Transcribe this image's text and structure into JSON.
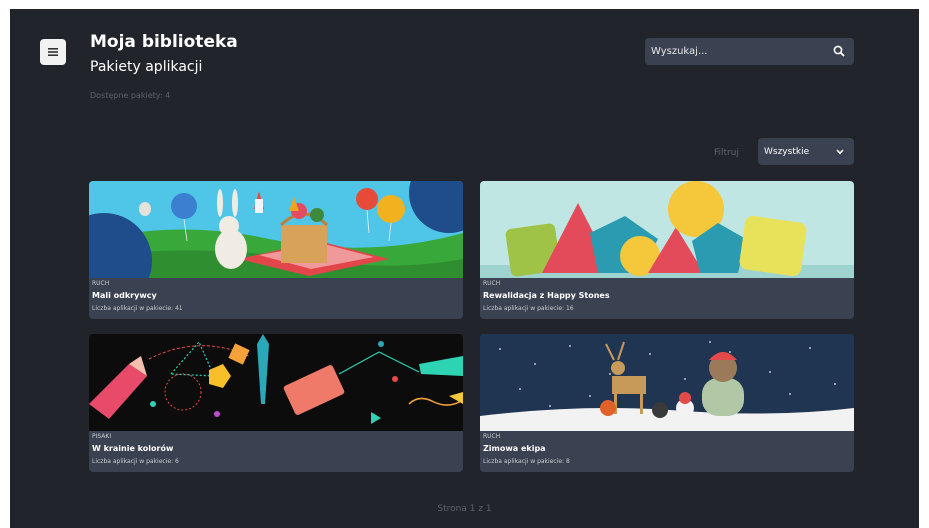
{
  "header": {
    "title": "Moja biblioteka",
    "subtitle": "Pakiety aplikacji",
    "packages_count": "Dostępne pakiety: 4"
  },
  "icons": {
    "menu": "hamburger-menu-icon",
    "search": "search-icon",
    "dropdown": "chevron-down-icon"
  },
  "search": {
    "placeholder": "Wyszukaj..."
  },
  "filter": {
    "label": "Filtruj",
    "selected": "Wszystkie"
  },
  "cards": [
    {
      "category": "RUCH",
      "name": "Mali odkrywcy",
      "meta": "Liczba aplikacji w pakiecie: 41",
      "image": "rabbit-picnic-illustration"
    },
    {
      "category": "RUCH",
      "name": "Rewalidacja z Happy Stones",
      "meta": "Liczba aplikacji w pakiecie: 16",
      "image": "colorful-shapes-illustration"
    },
    {
      "category": "PISAKI",
      "name": "W krainie kolorów",
      "meta": "Liczba aplikacji w pakiecie: 6",
      "image": "markers-drawing-illustration"
    },
    {
      "category": "RUCH",
      "name": "Zimowa ekipa",
      "meta": "Liczba aplikacji w pakiecie: 8",
      "image": "winter-animals-illustration"
    }
  ],
  "pagination": {
    "text": "Strona 1 z 1"
  },
  "colors": {
    "background": "#21252b",
    "panel": "#3a4150",
    "muted_text": "#5a616d"
  }
}
